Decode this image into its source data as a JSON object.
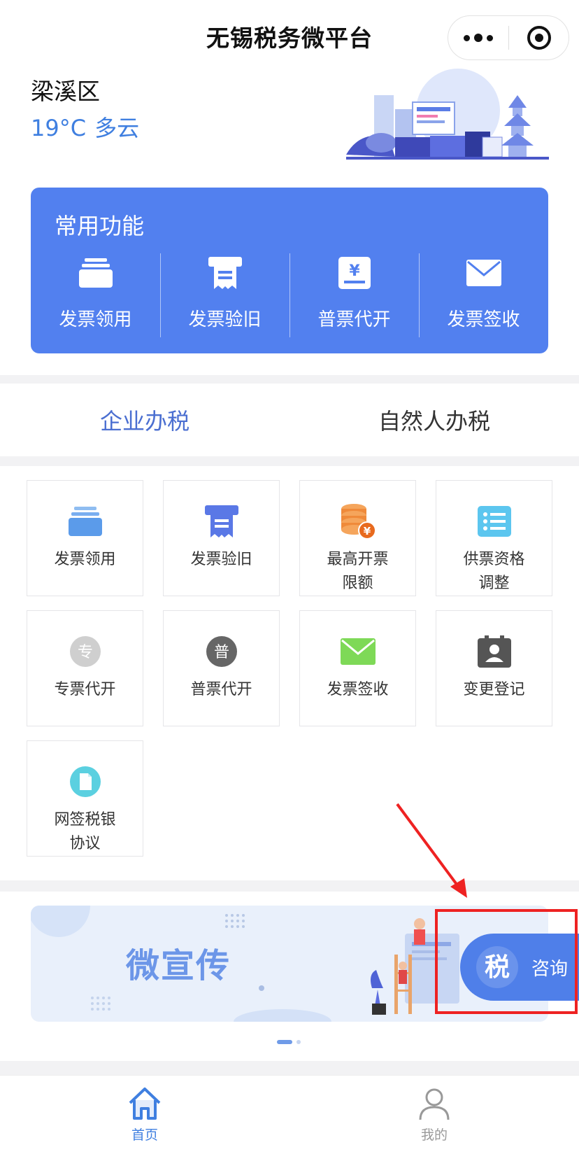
{
  "header": {
    "title": "无锡税务微平台",
    "more_icon": "more-dots-icon",
    "close_icon": "mini-program-close-icon"
  },
  "location": {
    "district": "梁溪区",
    "temperature": "19°C",
    "condition": "多云"
  },
  "common": {
    "title": "常用功能",
    "items": [
      {
        "label": "发票领用",
        "icon": "invoice-stack-icon"
      },
      {
        "label": "发票验旧",
        "icon": "invoice-print-icon"
      },
      {
        "label": "普票代开",
        "icon": "yen-document-icon"
      },
      {
        "label": "发票签收",
        "icon": "envelope-icon"
      }
    ]
  },
  "tabs": [
    {
      "label": "企业办税",
      "active": true
    },
    {
      "label": "自然人办税",
      "active": false
    }
  ],
  "grid": [
    {
      "label": "发票领用",
      "icon": "invoice-stack-icon",
      "color": "#5b9bea"
    },
    {
      "label": "发票验旧",
      "icon": "invoice-print-icon",
      "color": "#5a78e6"
    },
    {
      "label": "最高开票\n限额",
      "icon": "coins-yen-icon",
      "color": "#ef8a3a"
    },
    {
      "label": "供票资格\n调整",
      "icon": "list-icon",
      "color": "#5cc6ef"
    },
    {
      "label": "专票代开",
      "icon": "zhuan-badge-icon",
      "color": "#c8c8c8",
      "glyph": "专"
    },
    {
      "label": "普票代开",
      "icon": "pu-badge-icon",
      "color": "#666666",
      "glyph": "普"
    },
    {
      "label": "发票签收",
      "icon": "envelope-icon",
      "color": "#7ed957"
    },
    {
      "label": "变更登记",
      "icon": "id-card-icon",
      "color": "#555555"
    },
    {
      "label": "网签税银\n协议",
      "icon": "document-icon",
      "color": "#5bd0e0"
    }
  ],
  "banner": {
    "title": "微宣传"
  },
  "consult": {
    "label": "咨询",
    "icon": "tax-logo-icon",
    "glyph": "税"
  },
  "nav": [
    {
      "label": "首页",
      "icon": "home-icon",
      "active": true
    },
    {
      "label": "我的",
      "icon": "user-icon",
      "active": false
    }
  ],
  "colors": {
    "accent": "#5280ef",
    "tab_active": "#4b6fd1",
    "highlight": "#ee2222"
  }
}
